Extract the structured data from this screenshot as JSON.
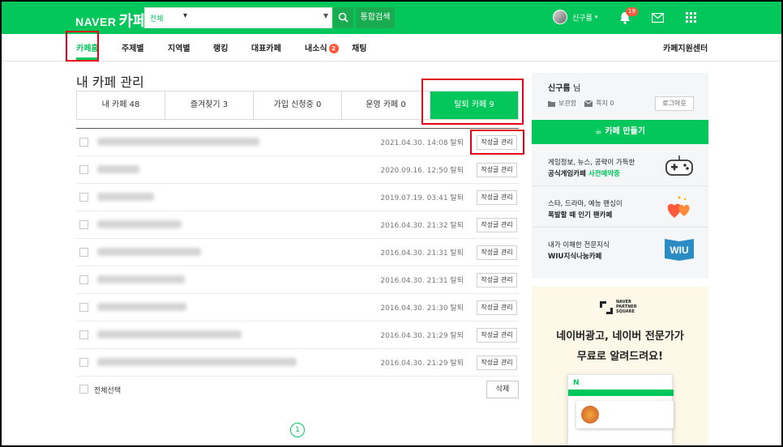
{
  "header": {
    "logo_naver": "NAVER",
    "logo_cafe": "카페",
    "search_scope": "전체",
    "search_value": "",
    "total_search": "통합검색",
    "username": "신구름",
    "notification_count": "19"
  },
  "subnav": {
    "items": [
      "카페홈",
      "주제별",
      "지역별",
      "랭킹",
      "대표카페",
      "내소식",
      "채팅"
    ],
    "news_badge": "2",
    "support": "카페지원센터"
  },
  "main": {
    "title": "내 카페 관리",
    "tabs": [
      "내 카페 48",
      "즐겨찾기 3",
      "가입 신청중 0",
      "운영 카페 0",
      "탈퇴 카페 9"
    ],
    "rows": [
      {
        "date": "2021.04.30. 14:08 탈퇴",
        "action": "작성글 관리"
      },
      {
        "date": "2020.09.16. 12:50 탈퇴",
        "action": "작성글 관리"
      },
      {
        "date": "2019.07.19. 03:41 탈퇴",
        "action": "작성글 관리"
      },
      {
        "date": "2016.04.30. 21:32 탈퇴",
        "action": "작성글 관리"
      },
      {
        "date": "2016.04.30. 21:31 탈퇴",
        "action": "작성글 관리"
      },
      {
        "date": "2016.04.30. 21:31 탈퇴",
        "action": "작성글 관리"
      },
      {
        "date": "2016.04.30. 21:30 탈퇴",
        "action": "작성글 관리"
      },
      {
        "date": "2016.04.30. 21:29 탈퇴",
        "action": "작성글 관리"
      },
      {
        "date": "2016.04.30. 21:29 탈퇴",
        "action": "작성글 관리"
      }
    ],
    "select_all": "전체선택",
    "delete": "삭제",
    "page": "1"
  },
  "side": {
    "user": "신구름",
    "user_suffix": "님",
    "storage": "보관함",
    "memo": "쪽지 0",
    "logout": "로그아웃",
    "make_cafe": "카페 만들기",
    "promos": [
      {
        "line1": "게임정보, 뉴스, 공략이 가득한",
        "line2a": "공식게임카페 ",
        "line2b": "사전예약중"
      },
      {
        "line1": "스타, 드라마, 예능 팬심이",
        "line2a": "폭발할 때 인기 팬카페",
        "line2b": ""
      },
      {
        "line1": "내가 이해한 전문지식",
        "line2a": "WIU지식나눔카페",
        "line2b": ""
      }
    ],
    "wiu_label": "WIU"
  },
  "ad": {
    "brand": [
      "NAVER",
      "PARTNER",
      "SQUARE"
    ],
    "line1": "네이버광고, 네이버 전문가가",
    "line2": "무료로 알려드려요!"
  },
  "colors": {
    "brand_green": "#03c75a",
    "highlight_red": "#e3001b"
  }
}
